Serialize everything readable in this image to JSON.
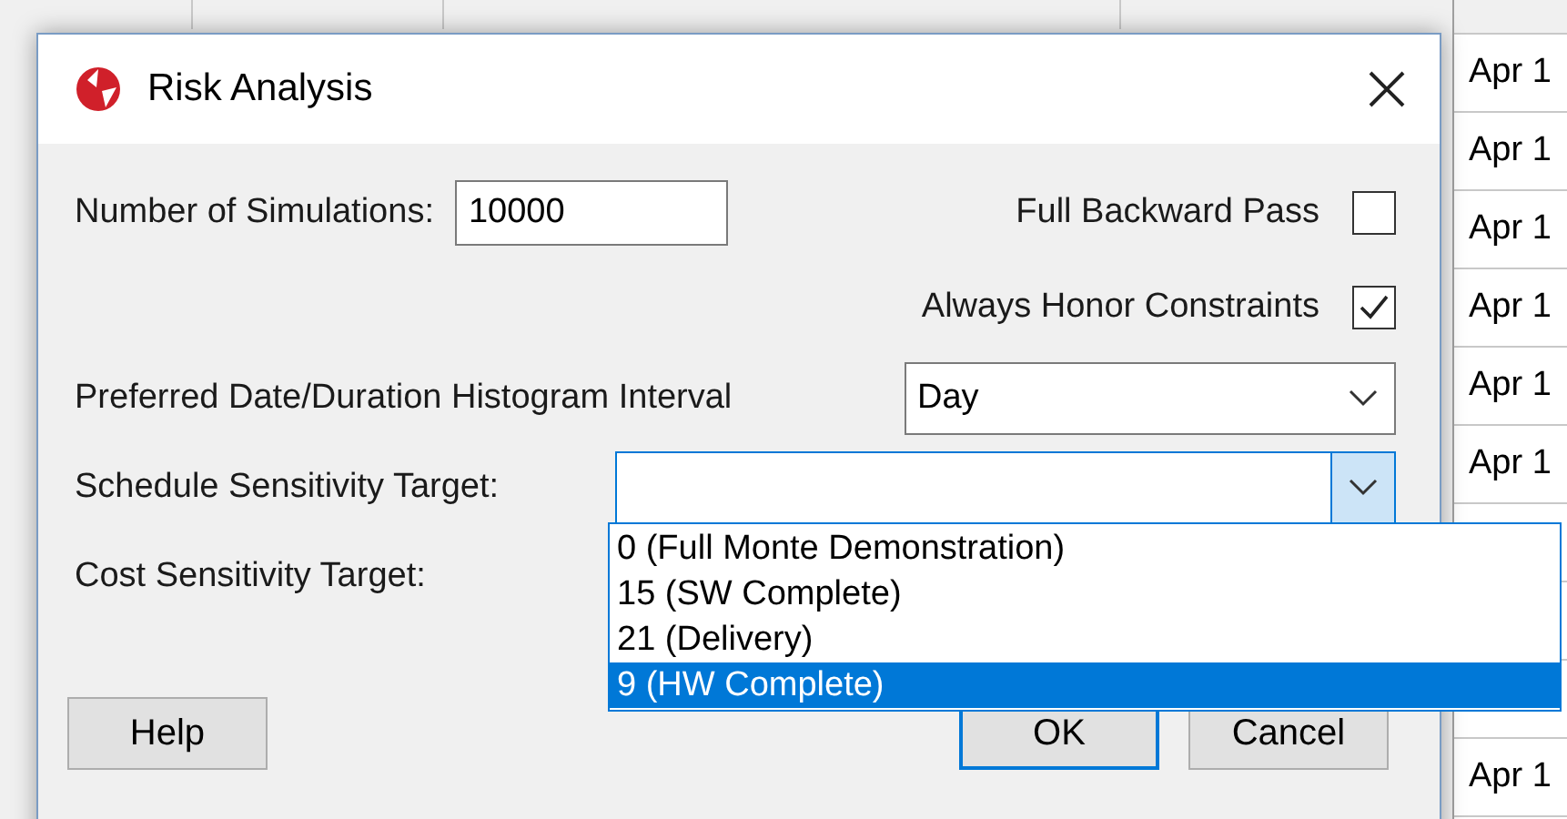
{
  "sheet": {
    "cells": [
      {
        "text": "Apr 1"
      },
      {
        "text": "Apr 1"
      },
      {
        "text": "Apr 1"
      },
      {
        "text": "Apr 1"
      },
      {
        "text": "Apr 1"
      },
      {
        "text": "Apr 1"
      },
      {
        "text": ""
      },
      {
        "text": ""
      },
      {
        "text": ""
      },
      {
        "text": "Apr 1"
      }
    ]
  },
  "dialog": {
    "title": "Risk Analysis",
    "simulations": {
      "label": "Number of Simulations:",
      "value": "10000"
    },
    "checks": [
      {
        "label": "Full Backward Pass",
        "checked": false
      },
      {
        "label": "Always Honor Constraints",
        "checked": true
      }
    ],
    "interval": {
      "label": "Preferred Date/Duration Histogram Interval",
      "value": "Day"
    },
    "schedule": {
      "label": "Schedule Sensitivity Target:",
      "expanded": true,
      "options": [
        {
          "label": "0 (Full Monte Demonstration)",
          "selected": false
        },
        {
          "label": "15 (SW Complete)",
          "selected": false
        },
        {
          "label": "21 (Delivery)",
          "selected": false
        },
        {
          "label": "9 (HW Complete)",
          "selected": true
        }
      ]
    },
    "cost": {
      "label": "Cost Sensitivity Target:"
    },
    "buttons": [
      {
        "label": "Help",
        "default": false
      },
      {
        "label": "OK",
        "default": true
      },
      {
        "label": "Cancel",
        "default": false
      }
    ]
  }
}
